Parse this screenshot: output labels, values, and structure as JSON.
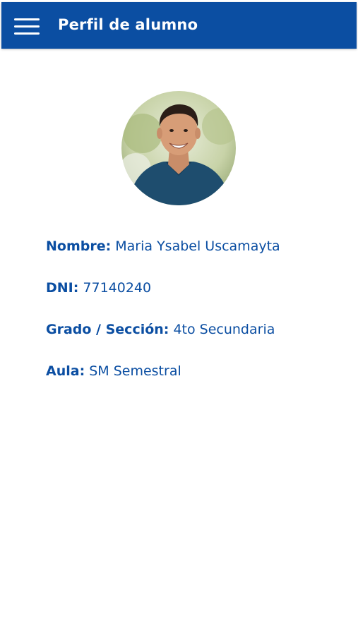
{
  "header": {
    "title": "Perfil de alumno",
    "menu_icon": "hamburger-menu-icon"
  },
  "profile": {
    "photo": "student-avatar",
    "fields": [
      {
        "label": "Nombre:",
        "value": "Maria Ysabel Uscamayta"
      },
      {
        "label": "DNI:",
        "value": "77140240"
      },
      {
        "label": "Grado / Sección:",
        "value": "4to Secundaria"
      },
      {
        "label": "Aula:",
        "value": "SM Semestral"
      }
    ]
  },
  "colors": {
    "primary": "#0b4ea2",
    "background": "#ffffff",
    "header_text": "#ffffff"
  }
}
